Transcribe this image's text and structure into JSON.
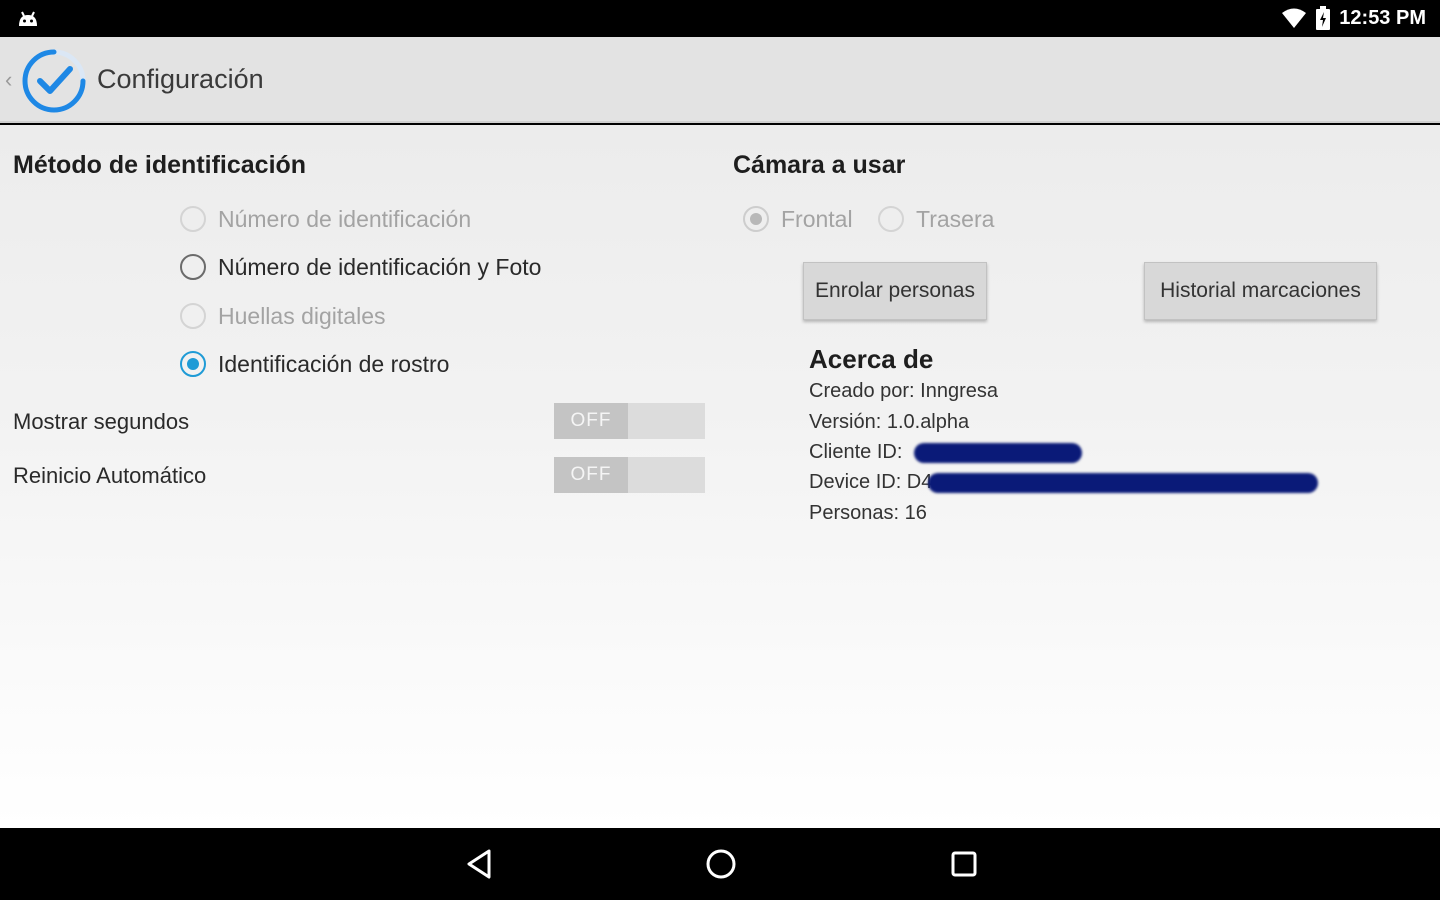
{
  "status_bar": {
    "time": "12:53 PM",
    "icons": [
      "android-icon",
      "wifi-icon",
      "battery-icon"
    ]
  },
  "action_bar": {
    "title": "Configuración",
    "back_icon": "chevron-left-icon",
    "logo_icon": "check-circle-logo-icon",
    "accent_color": "#1e88e5"
  },
  "identification": {
    "title": "Método de identificación",
    "options": [
      {
        "label": "Número de identificación",
        "checked": false,
        "enabled": false
      },
      {
        "label": "Número de identificación y Foto",
        "checked": false,
        "enabled": true
      },
      {
        "label": "Huellas digitales",
        "checked": false,
        "enabled": false
      },
      {
        "label": "Identificación de rostro",
        "checked": true,
        "enabled": true
      }
    ]
  },
  "settings": {
    "show_seconds": {
      "label": "Mostrar segundos",
      "state": "OFF"
    },
    "auto_restart": {
      "label": "Reinicio Automático",
      "state": "OFF"
    }
  },
  "camera": {
    "title": "Cámara a usar",
    "options": [
      {
        "label": "Frontal",
        "checked": true,
        "enabled": false
      },
      {
        "label": "Trasera",
        "checked": false,
        "enabled": false
      }
    ]
  },
  "buttons": {
    "enroll": "Enrolar personas",
    "history": "Historial marcaciones"
  },
  "about": {
    "title": "Acerca de",
    "created_by": "Creado por: Inngresa",
    "version_label": "Versión:",
    "version_value": "1.0.alpha",
    "client_id_label": "Cliente ID:",
    "device_id_label": "Device ID: D4",
    "persons_label": "Personas:",
    "persons_value": "16"
  },
  "nav_bar": {
    "icons": [
      "back-triangle-icon",
      "home-circle-icon",
      "recents-square-icon"
    ]
  },
  "colors": {
    "radio_checked": "#1f9bd6",
    "redaction": "#0a1a78"
  }
}
